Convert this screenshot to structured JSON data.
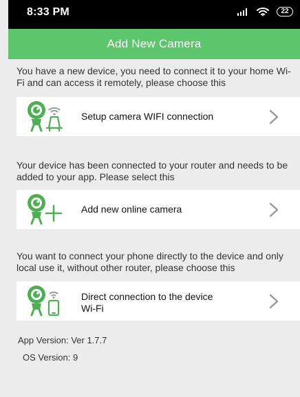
{
  "status_bar": {
    "time": "8:33 PM",
    "battery": "22"
  },
  "header": {
    "title": "Add New Camera"
  },
  "sections": [
    {
      "description": "You have a new device, you need to connect it to your home Wi-Fi and can access it remotely, please choose this",
      "option_label": "Setup camera WIFI connection",
      "icon_name": "camera-wifi-router-icon"
    },
    {
      "description": "Your device has been connected to your router and needs to be added to your app. Please select this",
      "option_label": "Add new online camera",
      "icon_name": "camera-add-icon"
    },
    {
      "description": "You want to connect your phone directly to the device and only local use it, without other router, please choose this",
      "option_label": "Direct connection to the device\nWi-Fi",
      "icon_name": "camera-phone-wifi-icon"
    }
  ],
  "footer": {
    "app_version": "App Version: Ver 1.7.7",
    "os_version": "OS Version: 9"
  },
  "colors": {
    "header_bg": "#5cc66b",
    "icon_green": "#4caf50",
    "page_bg": "#ececec",
    "status_bar_bg": "#000000"
  }
}
